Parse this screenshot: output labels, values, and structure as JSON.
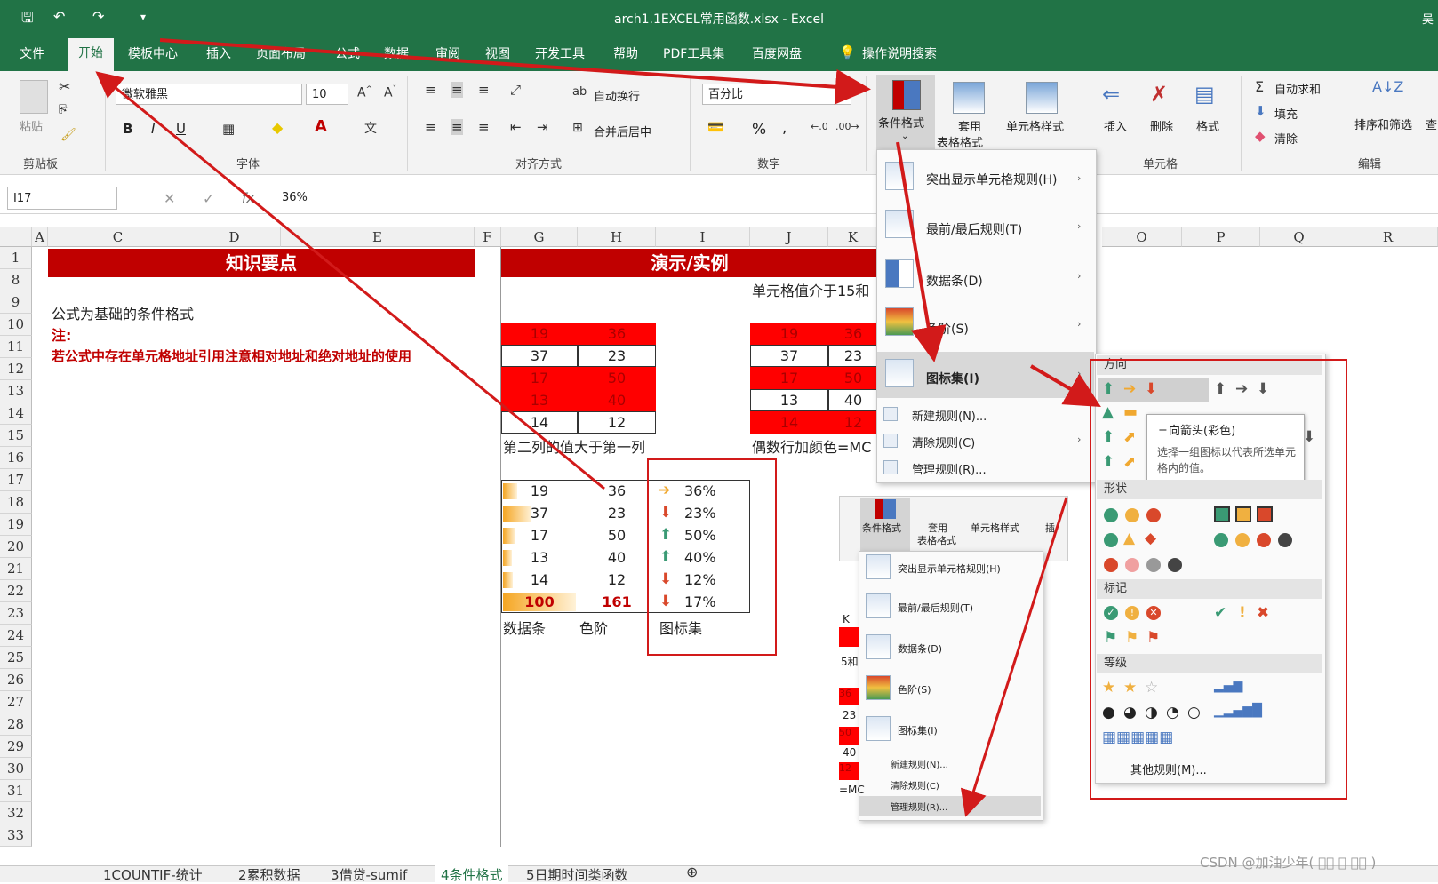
{
  "titlebar": {
    "title": "arch1.1EXCEL常用函数.xlsx  -  Excel",
    "user_initial": "吴"
  },
  "menu": [
    "文件",
    "开始",
    "模板中心",
    "插入",
    "页面布局",
    "公式",
    "数据",
    "审阅",
    "视图",
    "开发工具",
    "帮助",
    "PDF工具集",
    "百度网盘",
    "操作说明搜索"
  ],
  "ribbon": {
    "clipboard": {
      "label": "剪贴板",
      "paste": "粘贴"
    },
    "font": {
      "label": "字体",
      "name": "微软雅黑",
      "size": "10",
      "bold": "B",
      "italic": "I",
      "underline": "U"
    },
    "align": {
      "label": "对齐方式",
      "wrap": "自动换行",
      "merge": "合并后居中"
    },
    "number": {
      "label": "数字",
      "format": "百分比",
      "percent": "%",
      "comma": ","
    },
    "styles": {
      "cond": "条件格式",
      "table1": "套用",
      "table2": "表格格式",
      "cellstyle": "单元格样式"
    },
    "cells": {
      "label": "单元格",
      "insert": "插入",
      "delete": "删除",
      "format": "格式"
    },
    "edit": {
      "label": "编辑",
      "autosum": "自动求和",
      "fill": "填充",
      "clear": "清除",
      "sort": "排序和筛选",
      "find": "查"
    }
  },
  "formula": {
    "namebox": "I17",
    "value": "36%"
  },
  "columns": [
    "A",
    "C",
    "D",
    "E",
    "F",
    "G",
    "H",
    "I",
    "J",
    "K",
    "O",
    "P",
    "Q",
    "R"
  ],
  "rows": [
    "1",
    "8",
    "9",
    "10",
    "11",
    "12",
    "13",
    "14",
    "15",
    "16",
    "17",
    "18",
    "19",
    "20",
    "21",
    "22",
    "23",
    "24",
    "25",
    "26",
    "27",
    "28",
    "29",
    "30",
    "31",
    "32",
    "33"
  ],
  "sheet": {
    "header_left": "知识要点",
    "header_right": "演示/实例",
    "r8_text": "单元格值介于15和",
    "r9_text": "公式为基础的条件格式",
    "r10_note": "注:",
    "r11_note": "若公式中存在单元格地址引用注意相对地址和绝对地址的使用",
    "table1": [
      [
        "19",
        "36"
      ],
      [
        "37",
        "23"
      ],
      [
        "17",
        "50"
      ],
      [
        "13",
        "40"
      ],
      [
        "14",
        "12"
      ]
    ],
    "table2": [
      [
        "19",
        "36"
      ],
      [
        "37",
        "23"
      ],
      [
        "17",
        "50"
      ],
      [
        "13",
        "40"
      ],
      [
        "14",
        "12"
      ]
    ],
    "r15_g": "第二列的值大于第一列",
    "r15_j": "偶数行加颜色=MC",
    "table3": [
      [
        "19",
        "36",
        "36%"
      ],
      [
        "37",
        "23",
        "23%"
      ],
      [
        "17",
        "50",
        "50%"
      ],
      [
        "13",
        "40",
        "40%"
      ],
      [
        "14",
        "12",
        "12%"
      ],
      [
        "100",
        "161",
        "17%"
      ]
    ],
    "r23_g": "数据条",
    "r23_h": "色阶",
    "r23_i": "图标集"
  },
  "cf_menu": {
    "items": [
      "突出显示单元格规则(H)",
      "最前/最后规则(T)",
      "数据条(D)",
      "色阶(S)",
      "图标集(I)"
    ],
    "small": [
      "新建规则(N)...",
      "清除规则(C)",
      "管理规则(R)..."
    ]
  },
  "cf_menu2": {
    "btn": "条件格式",
    "tbl1": "套用",
    "tbl2": "表格格式",
    "cs": "单元格样式",
    "ins": "插",
    "items": [
      "突出显示单元格规则(H)",
      "最前/最后规则(T)",
      "数据条(D)",
      "色阶(S)",
      "图标集(I)"
    ],
    "small": [
      "新建规则(N)...",
      "清除规则(C)",
      "管理规则(R)..."
    ],
    "side": [
      "K",
      "5和",
      "36",
      "23",
      "50",
      "40",
      "12",
      "=MC"
    ]
  },
  "iconsets": {
    "sections": [
      "方向",
      "形状",
      "标记",
      "等级"
    ],
    "tooltip_title": "三向箭头(彩色)",
    "tooltip_body": "选择一组图标以代表所选单元格内的值。",
    "more": "其他规则(M)..."
  },
  "sheet_tabs": [
    "1COUNTIF-统计",
    "2累积数据",
    "3借贷-sumif",
    "4条件格式",
    "5日期时间类函数"
  ],
  "watermark": "CSDN @加油少年( 􀀀􀀀 􀀀 􀀀􀀀 )",
  "colors": {
    "excel_green": "#217346",
    "red": "#c00000",
    "annotation": "#d21a1a"
  }
}
